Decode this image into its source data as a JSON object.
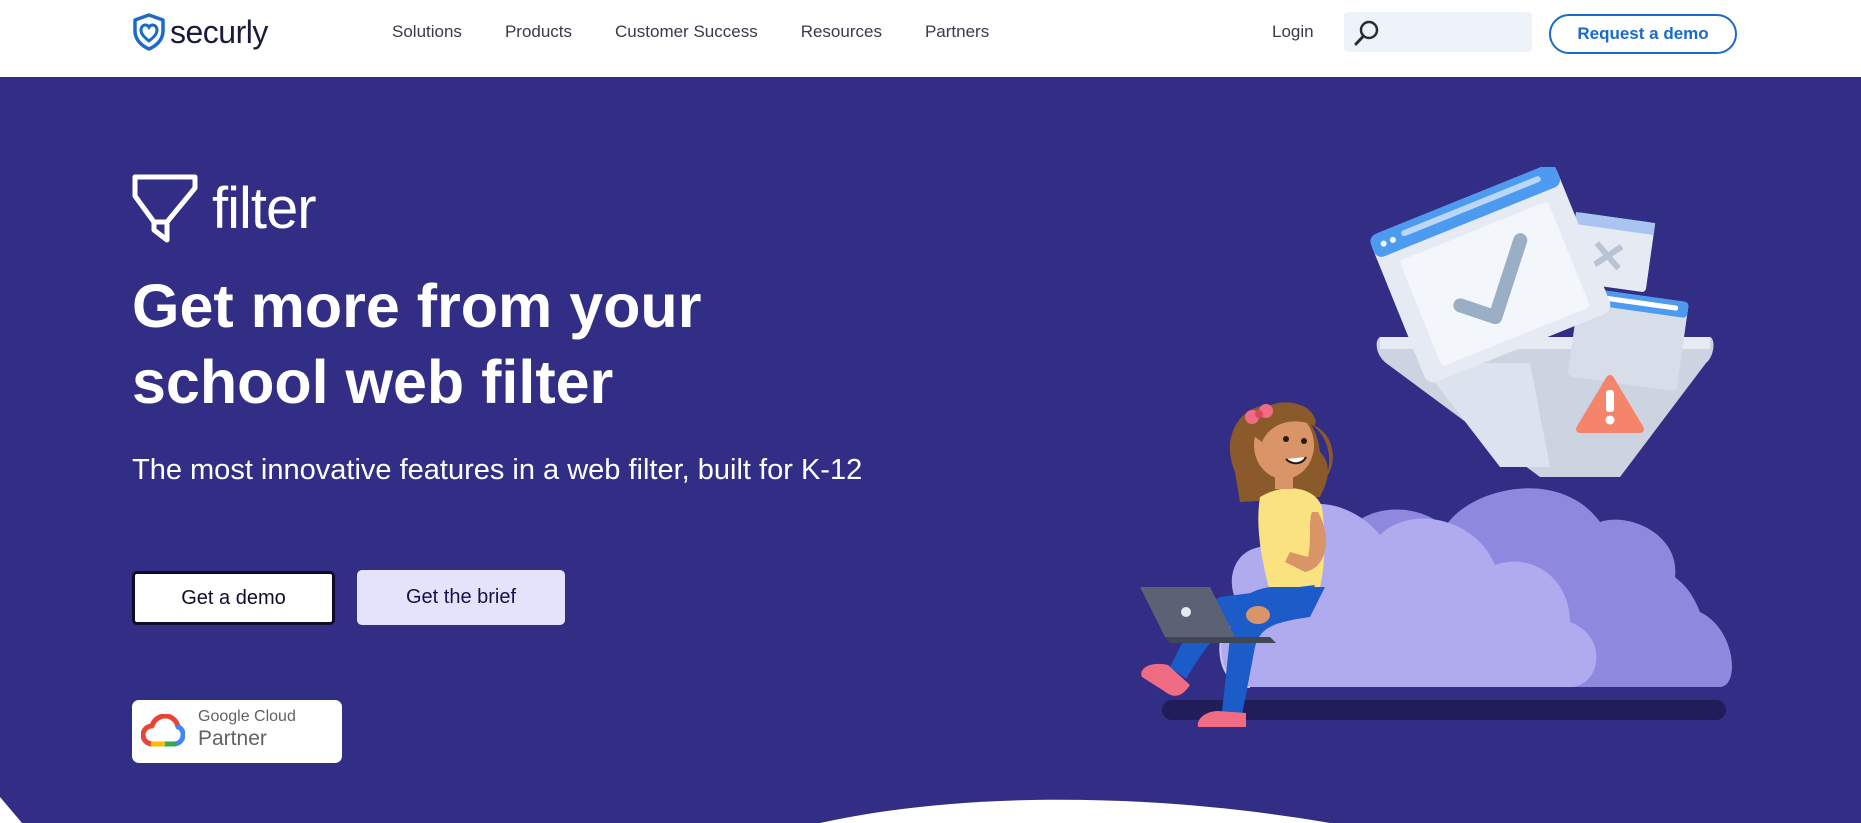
{
  "header": {
    "logo_text": "securly",
    "nav": [
      "Solutions",
      "Products",
      "Customer Success",
      "Resources",
      "Partners"
    ],
    "login": "Login",
    "search_placeholder": "",
    "cta": "Request a demo"
  },
  "hero": {
    "product_name": "filter",
    "headline": "Get more from your school web filter",
    "subhead": "The most innovative features in a web filter, built for K-12",
    "primary_button": "Get a demo",
    "secondary_button": "Get the brief",
    "badge": {
      "line1": "Google Cloud",
      "line2": "Partner"
    }
  },
  "colors": {
    "hero_bg": "#332e85",
    "brand_blue": "#1b6ac9",
    "cloud": "#b0abef",
    "button_secondary_bg": "#e4e3fb"
  }
}
